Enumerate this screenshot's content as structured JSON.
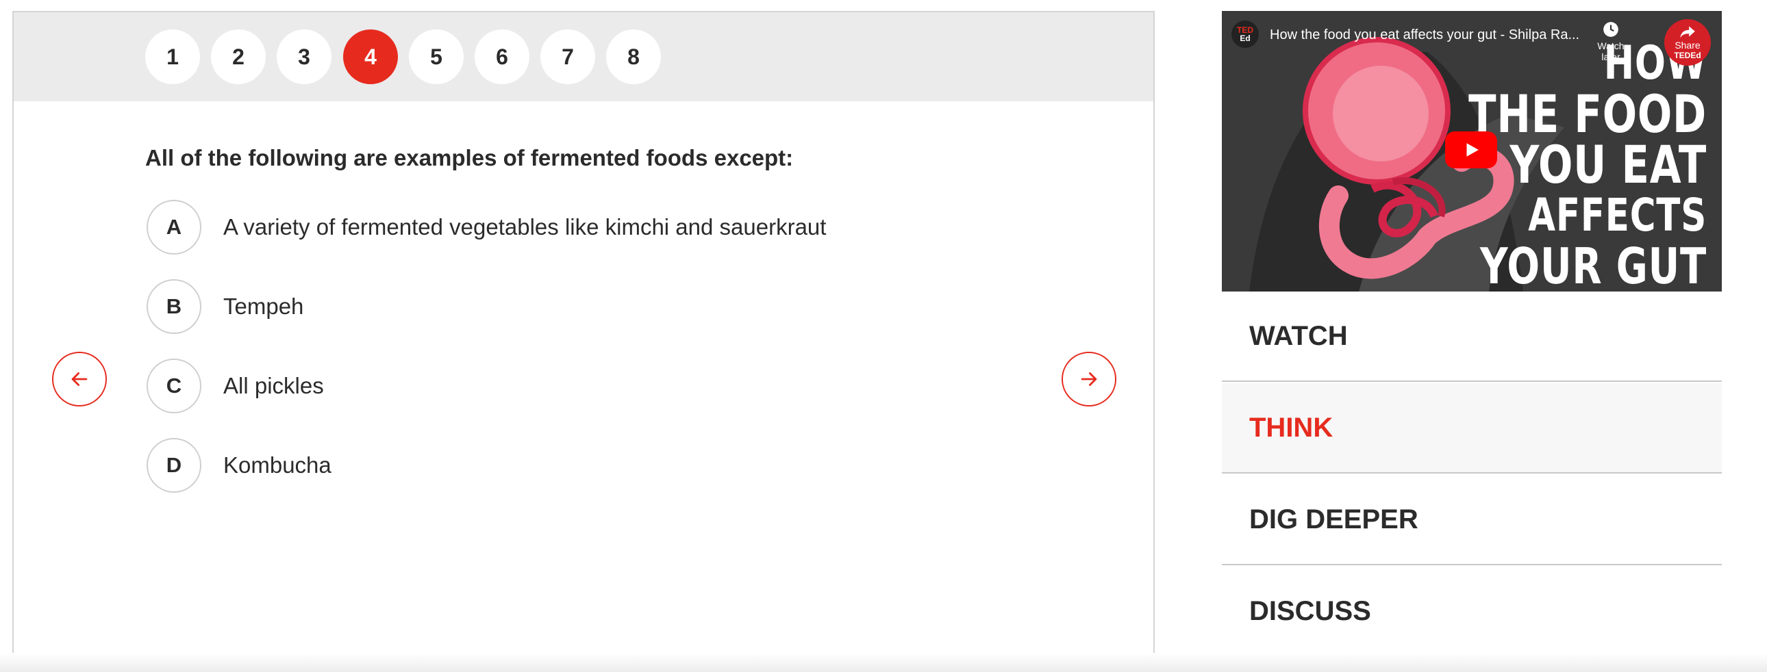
{
  "quiz": {
    "question_numbers": [
      "1",
      "2",
      "3",
      "4",
      "5",
      "6",
      "7",
      "8"
    ],
    "active_question": "4",
    "question": "All of the following are examples of fermented foods except:",
    "options": [
      {
        "letter": "A",
        "text": "A variety of fermented vegetables like kimchi and sauerkraut"
      },
      {
        "letter": "B",
        "text": "Tempeh"
      },
      {
        "letter": "C",
        "text": "All pickles"
      },
      {
        "letter": "D",
        "text": "Kombucha"
      }
    ]
  },
  "video": {
    "title": "How the food you eat affects your gut - Shilpa Ra...",
    "channel_badge_top": "TED",
    "channel_badge_bottom": "Ed",
    "watch_later_label": "Watch later",
    "share_label": "Share",
    "share_badge": "TEDEd",
    "thumbnail_lines": [
      "HOW",
      "THE FOOD",
      "YOU EAT",
      "AFFECTS",
      "YOUR GUT"
    ]
  },
  "tabs": [
    {
      "label": "WATCH",
      "active": false
    },
    {
      "label": "THINK",
      "active": true
    },
    {
      "label": "DIG DEEPER",
      "active": false
    },
    {
      "label": "DISCUSS",
      "active": false
    }
  ],
  "colors": {
    "accent": "#e62b1e",
    "nav_bg": "#ebebeb",
    "text": "#2b2b2b"
  },
  "icons": {
    "prev": "arrow-left-icon",
    "next": "arrow-right-icon",
    "play": "play-icon",
    "watch_later": "clock-icon",
    "share": "share-icon"
  }
}
